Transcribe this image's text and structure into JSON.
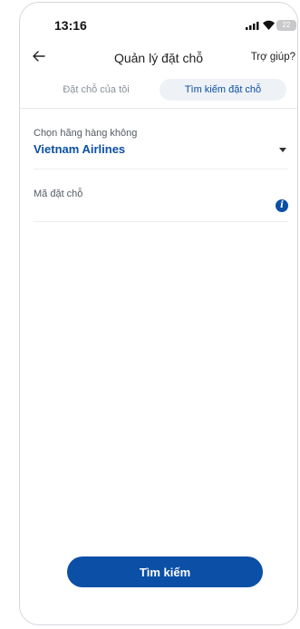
{
  "status_bar": {
    "time": "13:16",
    "battery_level": "22"
  },
  "header": {
    "title": "Quản lý đặt chỗ",
    "help": "Trợ giúp?"
  },
  "tabs": [
    {
      "label": "Đặt chỗ của tôi",
      "active": false
    },
    {
      "label": "Tìm kiếm đặt chỗ",
      "active": true
    }
  ],
  "form": {
    "airline": {
      "label": "Chọn hãng hàng không",
      "value": "Vietnam Airlines"
    },
    "booking_code": {
      "label": "Mã đặt chỗ",
      "value": ""
    }
  },
  "search_button": {
    "label": "Tìm kiếm"
  },
  "colors": {
    "brand": "#0b4fa6",
    "tab_bg": "#eef1f6"
  }
}
